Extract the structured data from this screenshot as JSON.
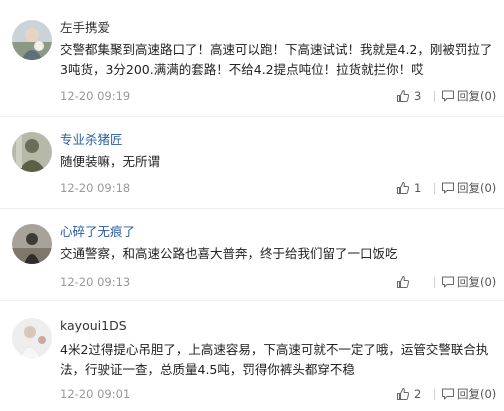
{
  "comments": [
    {
      "username": "左手携爱",
      "username_color": "#333333",
      "text": "交警都集聚到高速路口了！高速可以跑！下高速试试！我就是4.2，刚被罚拉了3吨货，3分200.满满的套路！不给4.2提点吨位！拉货就拦你！哎",
      "time": "12-20 09:19",
      "likes": "3",
      "reply_label": "回复(0)"
    },
    {
      "username": "专业杀猪匠",
      "username_color": "#2a5d9f",
      "text": "随便装嘛，无所谓",
      "time": "12-20 09:18",
      "likes": "1",
      "reply_label": "回复(0)"
    },
    {
      "username": "心碎了无痕了",
      "username_color": "#2a5d9f",
      "text": "交通警察，和高速公路也喜大普奔，终于给我们留了一口饭吃",
      "time": "12-20 09:13",
      "likes": "",
      "reply_label": "回复(0)"
    },
    {
      "username": "kayoui1DS",
      "username_color": "#333333",
      "text": "4米2过得提心吊胆了，上高速容易，下高速可就不一定了哦，运管交警联合执法，行驶证一查，总质量4.5吨，罚得你裤头都穿不稳",
      "time": "12-20 09:01",
      "likes": "2",
      "reply_label": "回复(0)"
    }
  ],
  "icons": {
    "like": "thumbs-up-icon",
    "reply": "speech-bubble-icon"
  },
  "colors": {
    "link": "#2a5d9f",
    "meta": "#999999",
    "icon": "#666666"
  }
}
